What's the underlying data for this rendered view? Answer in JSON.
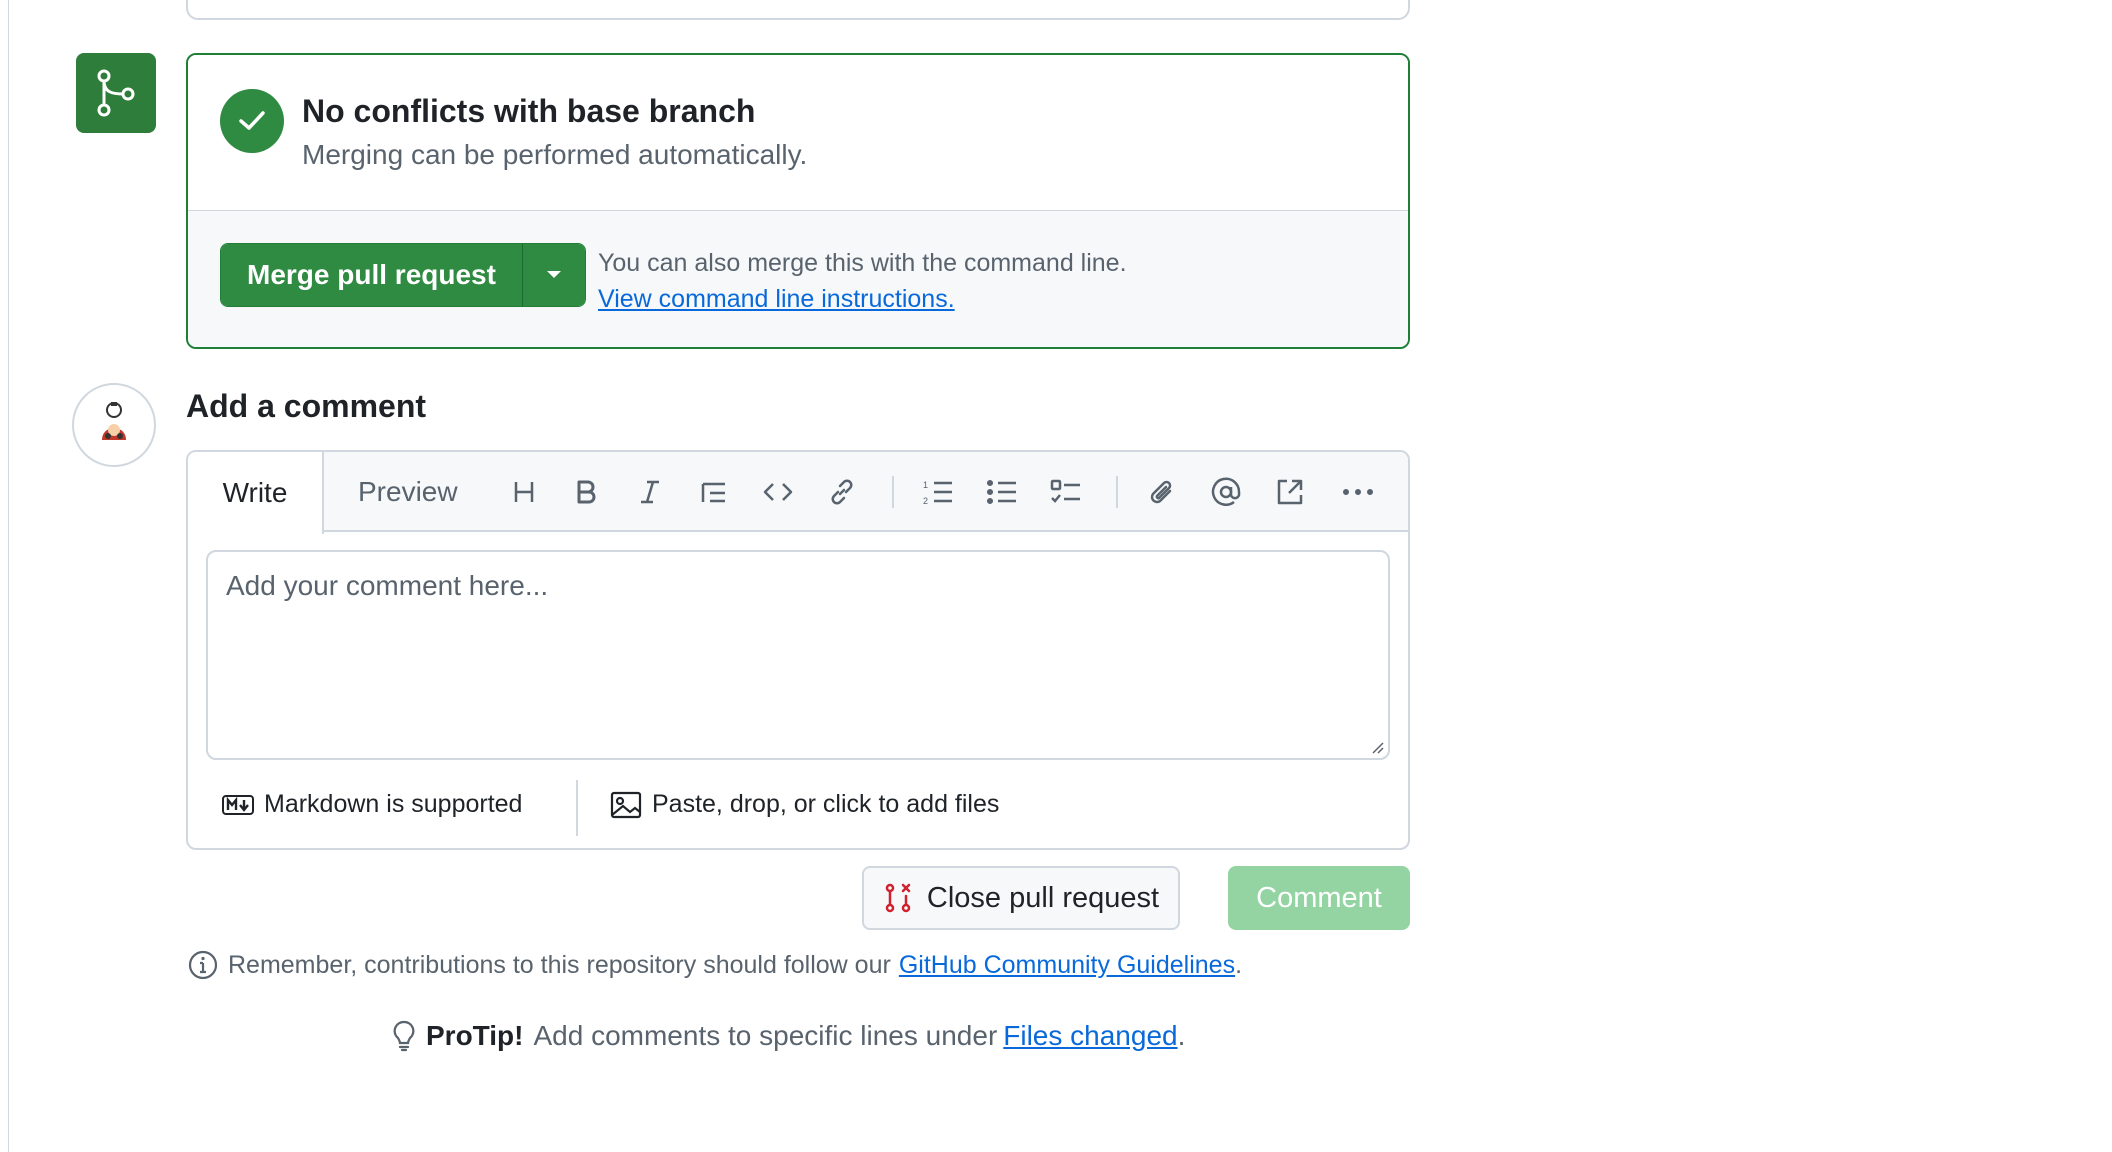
{
  "merge": {
    "title": "No conflicts with base branch",
    "subtitle": "Merging can be performed automatically.",
    "merge_button": "Merge pull request",
    "info_text": "You can also merge this with the command line.",
    "info_link": "View command line instructions."
  },
  "comment": {
    "heading": "Add a comment",
    "tabs": {
      "write": "Write",
      "preview": "Preview"
    },
    "placeholder": "Add your comment here...",
    "markdown_note": "Markdown is supported",
    "files_note": "Paste, drop, or click to add files",
    "toolbar_icons": [
      "heading-icon",
      "bold-icon",
      "italic-icon",
      "quote-icon",
      "code-icon",
      "link-icon",
      "ordered-list-icon",
      "unordered-list-icon",
      "task-list-icon",
      "attach-icon",
      "mention-icon",
      "reference-icon",
      "more-icon"
    ]
  },
  "actions": {
    "close_button": "Close pull request",
    "comment_button": "Comment"
  },
  "remember": {
    "text": "Remember, contributions to this repository should follow our",
    "link": "GitHub Community Guidelines",
    "suffix": "."
  },
  "protip": {
    "bold": "ProTip!",
    "text": "Add comments to specific lines under",
    "link": "Files changed",
    "suffix": "."
  },
  "colors": {
    "merge_green": "#2f8a42",
    "comment_disabled": "#94d3a2",
    "link_blue": "#0969da",
    "close_red": "#cf222e"
  }
}
